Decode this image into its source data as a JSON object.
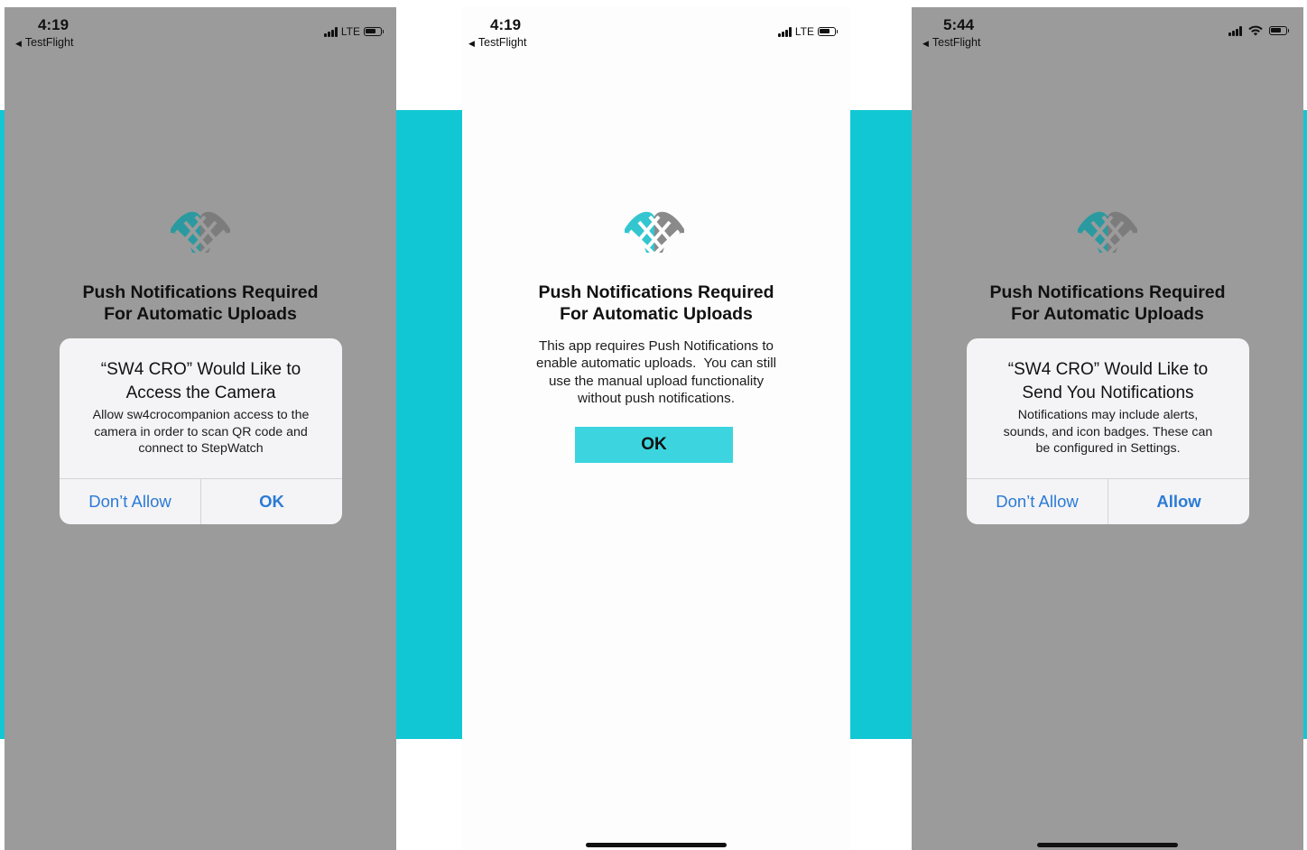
{
  "colors": {
    "teal_band": "#12c7d4",
    "ok_button": "#3cd5df",
    "alert_action": "#2b7bd6",
    "dim_background": "#9b9b9b"
  },
  "screens": [
    {
      "status": {
        "time": "4:19",
        "back_label": "TestFlight",
        "network": "LTE",
        "icons": [
          "signal-icon",
          "battery-icon"
        ]
      },
      "heading": [
        "Push Notifications Required",
        "For Automatic Uploads"
      ],
      "alert": {
        "title": [
          "“SW4 CRO” Would Like to",
          "Access the Camera"
        ],
        "message": [
          "Allow sw4crocompanion access to the",
          "camera in order to scan QR code and",
          "connect to StepWatch"
        ],
        "left_button": "Don’t Allow",
        "right_button": "OK"
      }
    },
    {
      "status": {
        "time": "4:19",
        "back_label": "TestFlight",
        "network": "LTE",
        "icons": [
          "signal-icon",
          "battery-icon"
        ]
      },
      "heading": [
        "Push Notifications Required",
        "For Automatic Uploads"
      ],
      "body": [
        "This app requires Push Notifications to",
        "enable automatic uploads.  You can still",
        "use the manual upload functionality",
        "without push notifications."
      ],
      "ok_button": "OK"
    },
    {
      "status": {
        "time": "5:44",
        "back_label": "TestFlight",
        "icons": [
          "signal-icon",
          "wifi-icon",
          "battery-icon"
        ]
      },
      "heading": [
        "Push Notifications Required",
        "For Automatic Uploads"
      ],
      "alert": {
        "title": [
          "“SW4 CRO” Would Like to",
          "Send You Notifications"
        ],
        "message": [
          "Notifications may include alerts,",
          "sounds, and icon badges. These can",
          "be configured in Settings."
        ],
        "left_button": "Don’t Allow",
        "right_button": "Allow"
      }
    }
  ]
}
